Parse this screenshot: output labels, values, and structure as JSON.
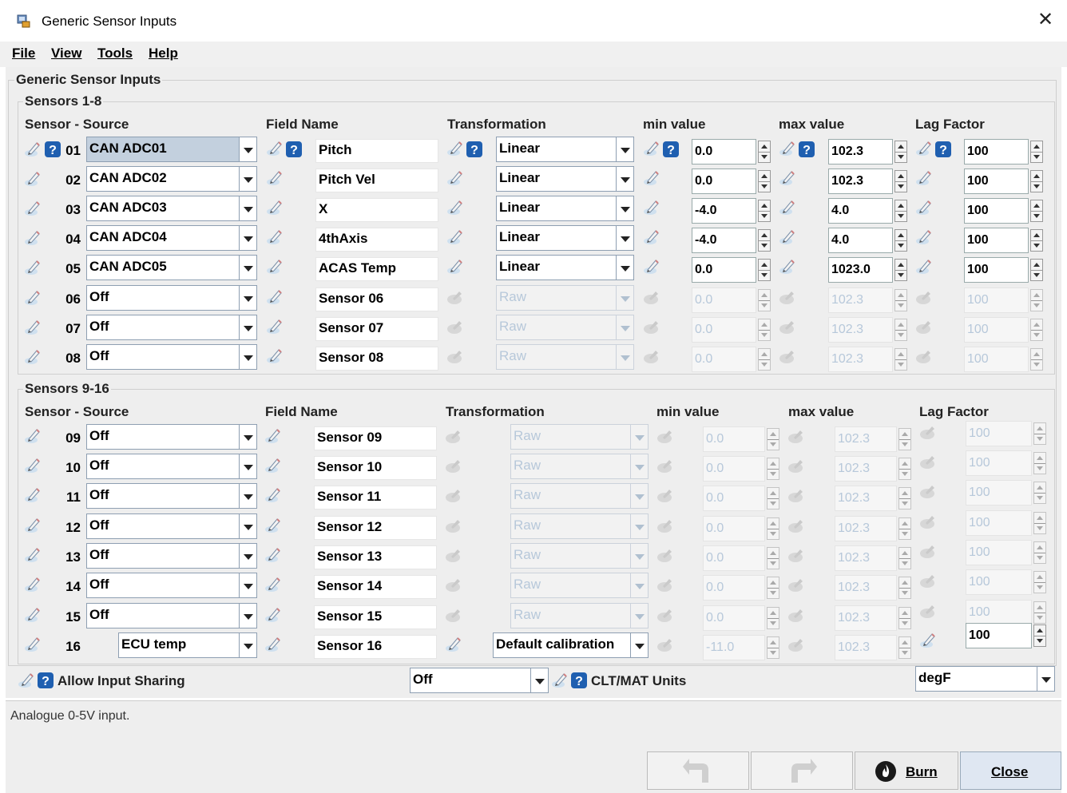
{
  "window": {
    "title": "Generic Sensor Inputs"
  },
  "menu": {
    "file": "File",
    "view": "View",
    "tools": "Tools",
    "help": "Help"
  },
  "panel_title": "Generic Sensor Inputs",
  "groups": {
    "g1": "Sensors 1-8",
    "g2": "Sensors 9-16"
  },
  "headers": {
    "source": "Sensor - Source",
    "field": "Field Name",
    "trans": "Transformation",
    "min": "min value",
    "max": "max value",
    "lag": "Lag Factor"
  },
  "rows1": [
    {
      "num": "01",
      "source": "CAN ADC01",
      "field": "Pitch",
      "trans": "Linear",
      "min": "0.0",
      "max": "102.3",
      "lag": "100"
    },
    {
      "num": "02",
      "source": "CAN ADC02",
      "field": "Pitch Vel",
      "trans": "Linear",
      "min": "0.0",
      "max": "102.3",
      "lag": "100"
    },
    {
      "num": "03",
      "source": "CAN ADC03",
      "field": "X",
      "trans": "Linear",
      "min": "-4.0",
      "max": "4.0",
      "lag": "100"
    },
    {
      "num": "04",
      "source": "CAN ADC04",
      "field": "4thAxis",
      "trans": "Linear",
      "min": "-4.0",
      "max": "4.0",
      "lag": "100"
    },
    {
      "num": "05",
      "source": "CAN ADC05",
      "field": "ACAS Temp",
      "trans": "Linear",
      "min": "0.0",
      "max": "1023.0",
      "lag": "100"
    },
    {
      "num": "06",
      "source": "Off",
      "field": "Sensor 06",
      "trans": "Raw",
      "min": "0.0",
      "max": "102.3",
      "lag": "100"
    },
    {
      "num": "07",
      "source": "Off",
      "field": "Sensor 07",
      "trans": "Raw",
      "min": "0.0",
      "max": "102.3",
      "lag": "100"
    },
    {
      "num": "08",
      "source": "Off",
      "field": "Sensor 08",
      "trans": "Raw",
      "min": "0.0",
      "max": "102.3",
      "lag": "100"
    }
  ],
  "rows2": [
    {
      "num": "09",
      "source": "Off",
      "field": "Sensor 09",
      "trans": "Raw",
      "min": "0.0",
      "max": "102.3",
      "lag": "100"
    },
    {
      "num": "10",
      "source": "Off",
      "field": "Sensor 10",
      "trans": "Raw",
      "min": "0.0",
      "max": "102.3",
      "lag": "100"
    },
    {
      "num": "11",
      "source": "Off",
      "field": "Sensor 11",
      "trans": "Raw",
      "min": "0.0",
      "max": "102.3",
      "lag": "100"
    },
    {
      "num": "12",
      "source": "Off",
      "field": "Sensor 12",
      "trans": "Raw",
      "min": "0.0",
      "max": "102.3",
      "lag": "100"
    },
    {
      "num": "13",
      "source": "Off",
      "field": "Sensor 13",
      "trans": "Raw",
      "min": "0.0",
      "max": "102.3",
      "lag": "100"
    },
    {
      "num": "14",
      "source": "Off",
      "field": "Sensor 14",
      "trans": "Raw",
      "min": "0.0",
      "max": "102.3",
      "lag": "100"
    },
    {
      "num": "15",
      "source": "Off",
      "field": "Sensor 15",
      "trans": "Raw",
      "min": "0.0",
      "max": "102.3",
      "lag": "100"
    },
    {
      "num": "16",
      "source": "ECU temp",
      "field": "Sensor 16",
      "trans": "Default calibration",
      "min": "-11.0",
      "max": "102.3",
      "lag": "100"
    }
  ],
  "allow_sharing": {
    "label": "Allow Input Sharing",
    "value": "Off"
  },
  "clt_units": {
    "label": "CLT/MAT Units",
    "value": "degF"
  },
  "status": "Analogue 0-5V input.",
  "buttons": {
    "burn": "Burn",
    "close": "Close"
  },
  "colors": {
    "selected_combo": "#c3d0de",
    "disabled_text": "#b7c8da",
    "help_icon": "#1f5fb0"
  }
}
